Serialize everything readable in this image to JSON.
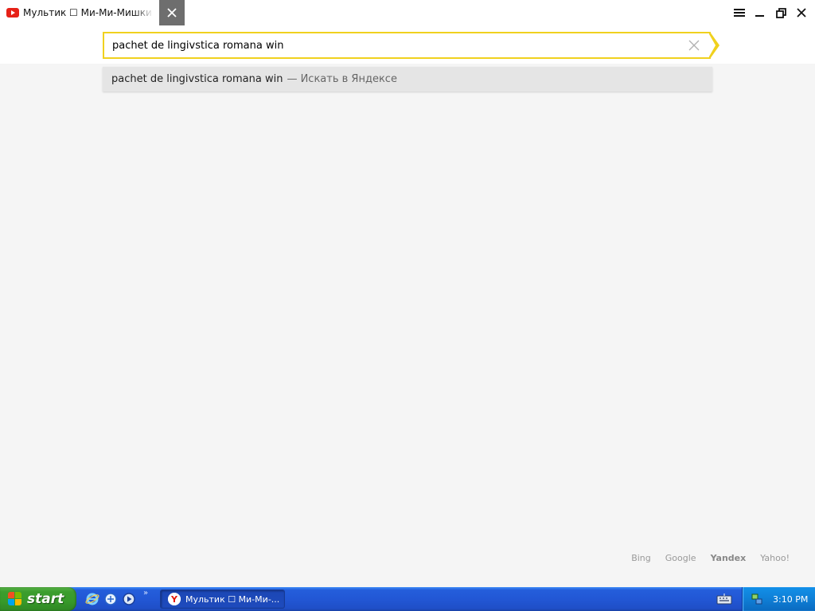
{
  "tab": {
    "title": "Мультик ☐ Ми-Ми-Мишки - ",
    "favicon": "youtube-icon"
  },
  "omnibox": {
    "value": "pachet de lingivstica romana win",
    "accent_color": "#f0d11e"
  },
  "suggestion": {
    "query": "pachet de lingivstica romana win",
    "action": "— Искать в Яндексе"
  },
  "search_engines": [
    {
      "label": "Bing",
      "active": false
    },
    {
      "label": "Google",
      "active": false
    },
    {
      "label": "Yandex",
      "active": true
    },
    {
      "label": "Yahoo!",
      "active": false
    }
  ],
  "taskbar": {
    "start_label": "start",
    "quick_launch_more": "»",
    "task_item_label": "Мультик ☐ Ми-Ми-...",
    "clock": "3:10 PM"
  }
}
